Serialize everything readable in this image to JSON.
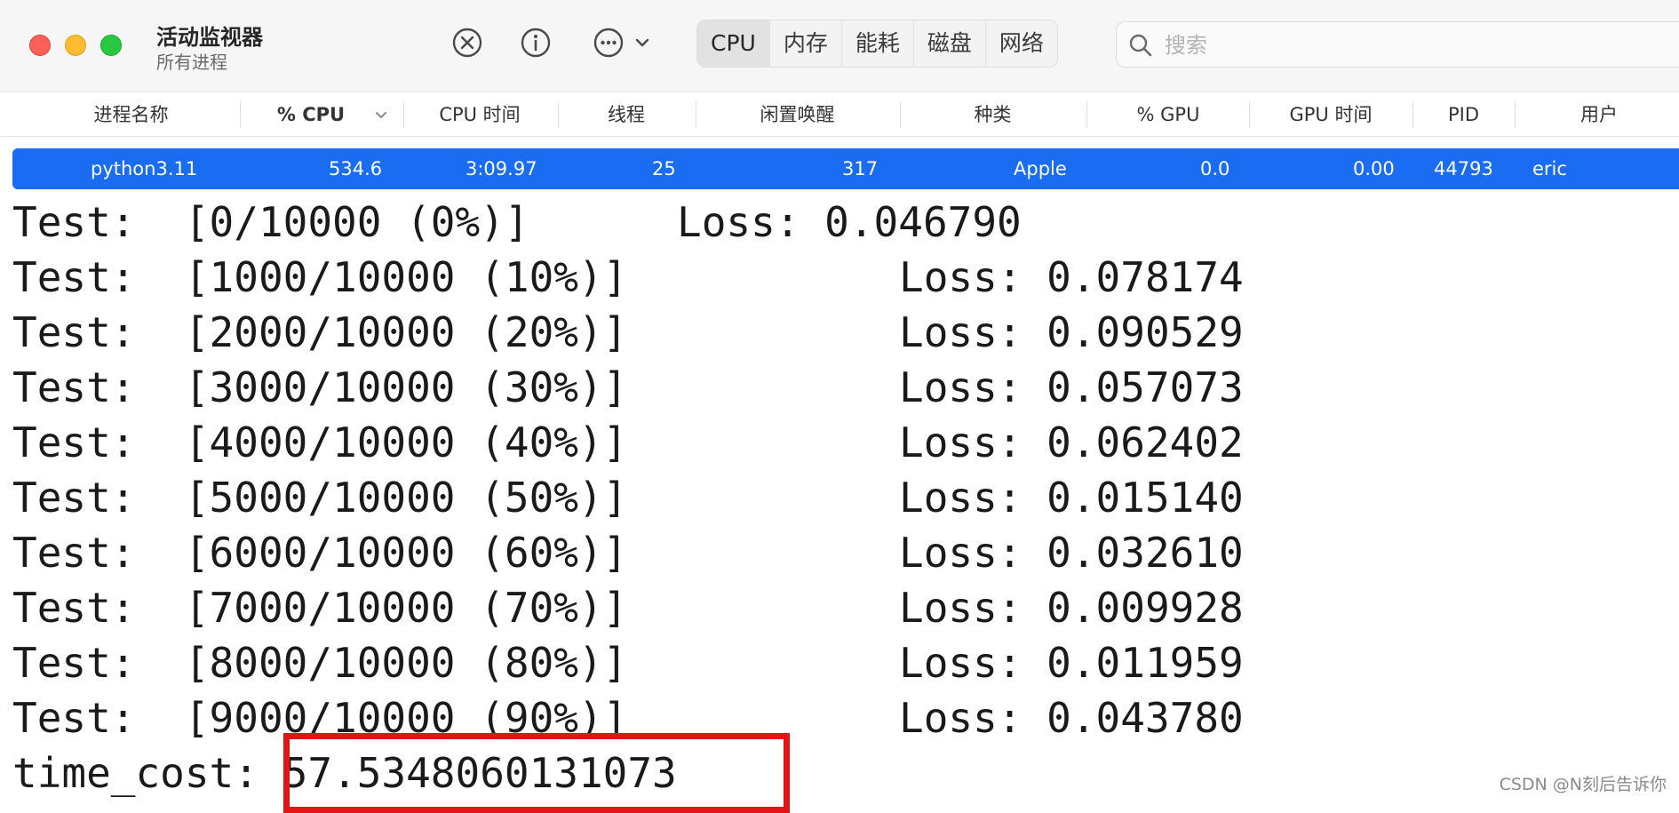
{
  "window": {
    "title": "活动监视器",
    "subtitle": "所有进程"
  },
  "toolbar": {
    "stop_icon": "x-circle-icon",
    "info_icon": "info-circle-icon",
    "more_icon": "ellipsis-circle-icon"
  },
  "tabs": [
    {
      "label": "CPU",
      "active": true
    },
    {
      "label": "内存",
      "active": false
    },
    {
      "label": "能耗",
      "active": false
    },
    {
      "label": "磁盘",
      "active": false
    },
    {
      "label": "网络",
      "active": false
    }
  ],
  "search": {
    "placeholder": "搜索",
    "value": ""
  },
  "columns": {
    "name": "进程名称",
    "cpu_pct": "% CPU",
    "cpu_time": "CPU 时间",
    "threads": "线程",
    "idle_wakeups": "闲置唤醒",
    "kind": "种类",
    "gpu_pct": "% GPU",
    "gpu_time": "GPU 时间",
    "pid": "PID",
    "user": "用户"
  },
  "process": {
    "name": "python3.11",
    "cpu_pct": "534.6",
    "cpu_time": "3:09.97",
    "threads": "25",
    "idle_wakeups": "317",
    "kind": "Apple",
    "gpu_pct": "0.0",
    "gpu_time": "0.00",
    "pid": "44793",
    "user": "eric"
  },
  "terminal": {
    "lines": [
      {
        "test": "Test:  [0/10000 (0%)]",
        "loss": "Loss: 0.046790"
      },
      {
        "test": "Test:  [1000/10000 (10%)]",
        "loss": "Loss: 0.078174"
      },
      {
        "test": "Test:  [2000/10000 (20%)]",
        "loss": "Loss: 0.090529"
      },
      {
        "test": "Test:  [3000/10000 (30%)]",
        "loss": "Loss: 0.057073"
      },
      {
        "test": "Test:  [4000/10000 (40%)]",
        "loss": "Loss: 0.062402"
      },
      {
        "test": "Test:  [5000/10000 (50%)]",
        "loss": "Loss: 0.015140"
      },
      {
        "test": "Test:  [6000/10000 (60%)]",
        "loss": "Loss: 0.032610"
      },
      {
        "test": "Test:  [7000/10000 (70%)]",
        "loss": "Loss: 0.009928"
      },
      {
        "test": "Test:  [8000/10000 (80%)]",
        "loss": "Loss: 0.011959"
      },
      {
        "test": "Test:  [9000/10000 (90%)]",
        "loss": "Loss: 0.043780"
      }
    ],
    "time_cost": "time_cost: 57.5348060131073"
  },
  "watermark": "CSDN @N刻后告诉你",
  "colors": {
    "selection": "#1a6cf2",
    "highlight_box": "#e41414"
  }
}
